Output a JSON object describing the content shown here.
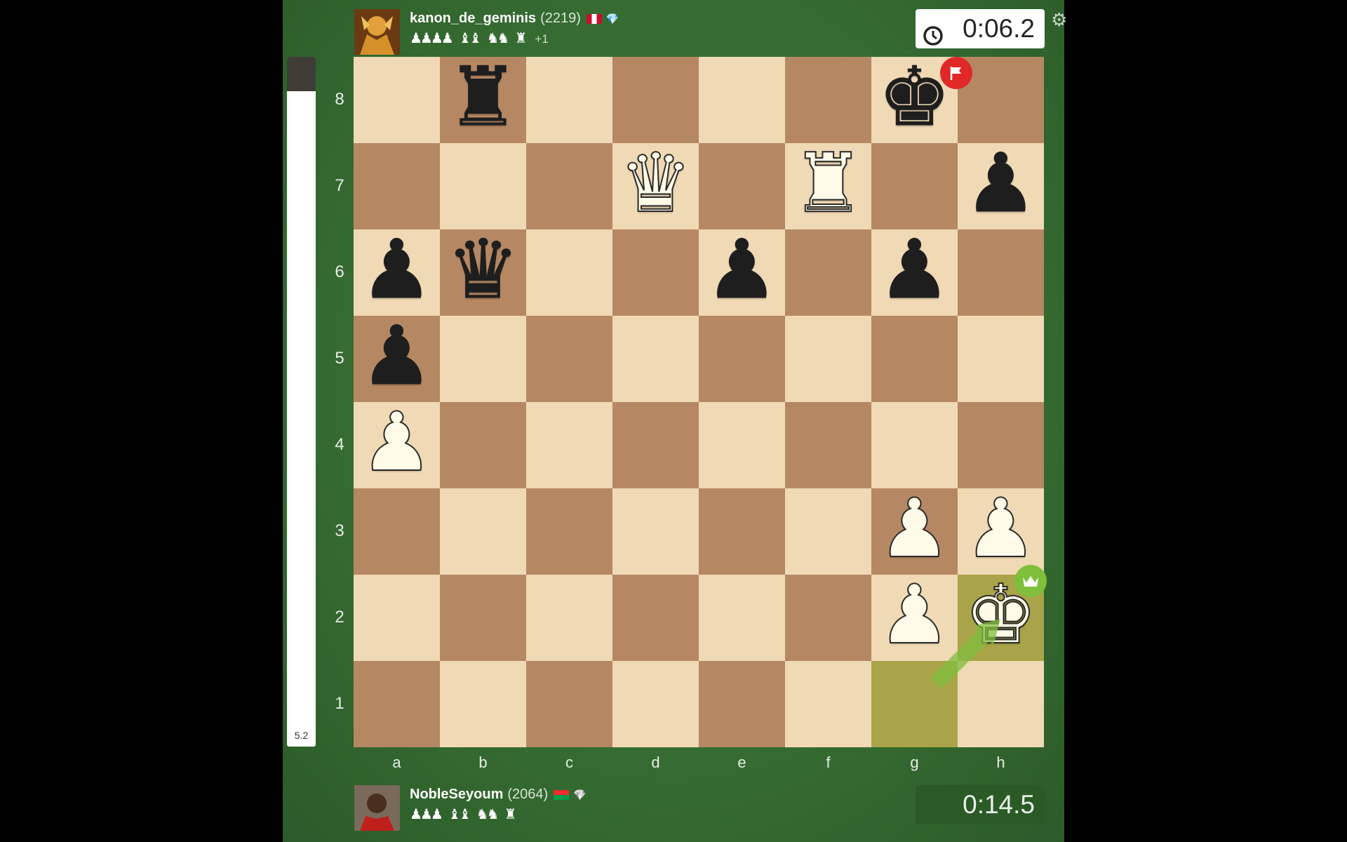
{
  "top_player": {
    "name": "kanon_de_geminis",
    "rating": "(2219)",
    "flag_colors": [
      "#c8102e",
      "#ffffff",
      "#c8102e"
    ],
    "badge_icon": "💎",
    "captured": [
      "♟♟♟♟",
      "♝♝",
      "♞♞",
      "♜"
    ],
    "material_advantage": "+1",
    "clock": "0:06.2",
    "clock_icon": "clock-icon"
  },
  "bottom_player": {
    "name": "NobleSeyoum",
    "rating": "(2064)",
    "flag_colors": [
      "#ef2b2d",
      "#009e49",
      "#fcd116"
    ],
    "badge_icon": "💎",
    "captured": [
      "♟♟♟",
      "♝♝",
      "♞♞",
      "♜"
    ],
    "clock": "0:14.5"
  },
  "evaluation": {
    "label": "5.2",
    "black_fraction": 0.05
  },
  "board": {
    "files": [
      "a",
      "b",
      "c",
      "d",
      "e",
      "f",
      "g",
      "h"
    ],
    "ranks": [
      "8",
      "7",
      "6",
      "5",
      "4",
      "3",
      "2",
      "1"
    ],
    "light_color": "#f0d9b5",
    "dark_color": "#b58863",
    "highlight_color": "#a9a449",
    "last_move": [
      "g1",
      "h2"
    ],
    "pieces": {
      "b8": "bR",
      "g8": "bK",
      "d7": "wQ",
      "f7": "wR",
      "h7": "bP",
      "a6": "bP",
      "b6": "bQ",
      "e6": "bP",
      "g6": "bP",
      "a5": "bP",
      "a4": "wP",
      "g3": "wP",
      "h3": "wP",
      "g2": "wP",
      "h2": "wK"
    },
    "flagged_square": "g8",
    "winner_square": "h2"
  }
}
